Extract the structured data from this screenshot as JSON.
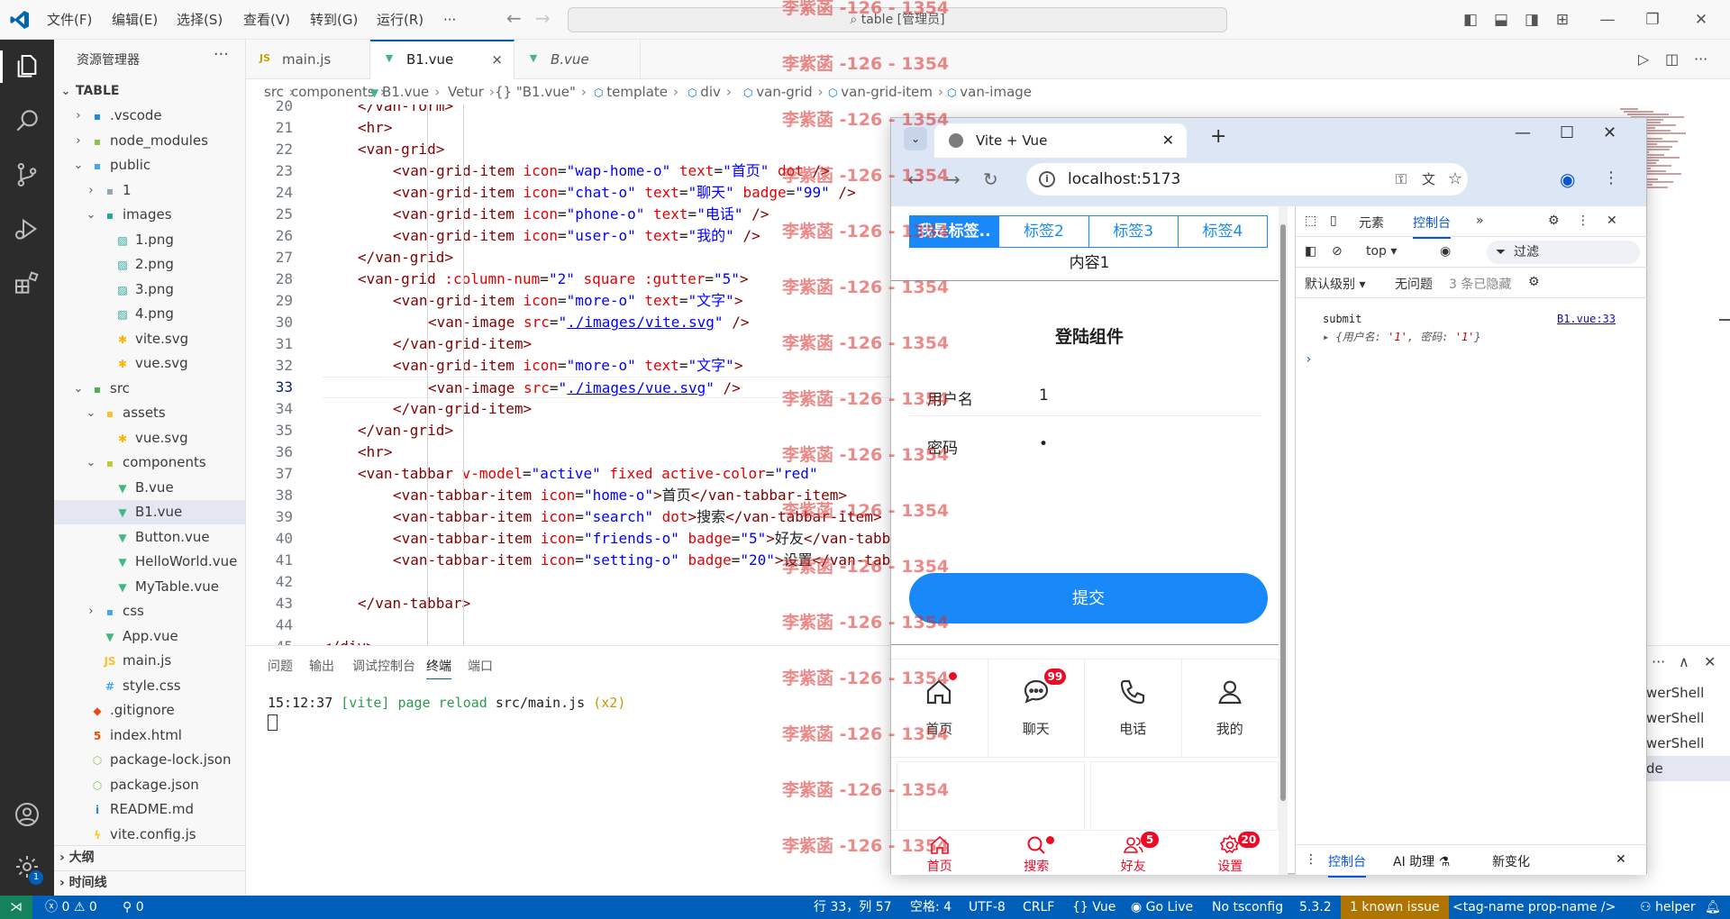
{
  "titlebar": {
    "menus": [
      "文件(F)",
      "编辑(E)",
      "选择(S)",
      "查看(V)",
      "转到(G)",
      "运行(R)",
      "···"
    ],
    "command_center": "table [管理员]"
  },
  "explorer": {
    "title": "资源管理器",
    "root": "TABLE",
    "items": [
      {
        "label": ".vscode",
        "depth": 1,
        "chev": "›",
        "icon": "folder-vscode"
      },
      {
        "label": "node_modules",
        "depth": 1,
        "chev": "›",
        "icon": "folder-node"
      },
      {
        "label": "public",
        "depth": 1,
        "chev": "⌄",
        "icon": "folder-public"
      },
      {
        "label": "1",
        "depth": 2,
        "chev": "›",
        "icon": "folder"
      },
      {
        "label": "images",
        "depth": 2,
        "chev": "⌄",
        "icon": "folder-images"
      },
      {
        "label": "1.png",
        "depth": 3,
        "chev": "",
        "icon": "image"
      },
      {
        "label": "2.png",
        "depth": 3,
        "chev": "",
        "icon": "image"
      },
      {
        "label": "3.png",
        "depth": 3,
        "chev": "",
        "icon": "image"
      },
      {
        "label": "4.png",
        "depth": 3,
        "chev": "",
        "icon": "image"
      },
      {
        "label": "vite.svg",
        "depth": 3,
        "chev": "",
        "icon": "svg"
      },
      {
        "label": "vue.svg",
        "depth": 3,
        "chev": "",
        "icon": "svg"
      },
      {
        "label": "src",
        "depth": 1,
        "chev": "⌄",
        "icon": "folder-src"
      },
      {
        "label": "assets",
        "depth": 2,
        "chev": "⌄",
        "icon": "folder-assets"
      },
      {
        "label": "vue.svg",
        "depth": 3,
        "chev": "",
        "icon": "svg"
      },
      {
        "label": "components",
        "depth": 2,
        "chev": "⌄",
        "icon": "folder-components"
      },
      {
        "label": "B.vue",
        "depth": 3,
        "chev": "",
        "icon": "vue"
      },
      {
        "label": "B1.vue",
        "depth": 3,
        "chev": "",
        "icon": "vue",
        "selected": true
      },
      {
        "label": "Button.vue",
        "depth": 3,
        "chev": "",
        "icon": "vue"
      },
      {
        "label": "HelloWorld.vue",
        "depth": 3,
        "chev": "",
        "icon": "vue"
      },
      {
        "label": "MyTable.vue",
        "depth": 3,
        "chev": "",
        "icon": "vue"
      },
      {
        "label": "css",
        "depth": 2,
        "chev": "›",
        "icon": "folder-css"
      },
      {
        "label": "App.vue",
        "depth": 2,
        "chev": "",
        "icon": "vue"
      },
      {
        "label": "main.js",
        "depth": 2,
        "chev": "",
        "icon": "js"
      },
      {
        "label": "style.css",
        "depth": 2,
        "chev": "",
        "icon": "css"
      },
      {
        "label": ".gitignore",
        "depth": 1,
        "chev": "",
        "icon": "git"
      },
      {
        "label": "index.html",
        "depth": 1,
        "chev": "",
        "icon": "html"
      },
      {
        "label": "package-lock.json",
        "depth": 1,
        "chev": "",
        "icon": "node"
      },
      {
        "label": "package.json",
        "depth": 1,
        "chev": "",
        "icon": "node"
      },
      {
        "label": "README.md",
        "depth": 1,
        "chev": "",
        "icon": "info"
      },
      {
        "label": "vite.config.js",
        "depth": 1,
        "chev": "",
        "icon": "vite"
      }
    ],
    "outline": "大纲",
    "timeline": "时间线"
  },
  "tabs": [
    {
      "label": "main.js",
      "icon": "js"
    },
    {
      "label": "B1.vue",
      "icon": "vue",
      "active": true,
      "close": "×"
    },
    {
      "label": "B.vue",
      "icon": "vue",
      "italic": true
    }
  ],
  "breadcrumb": [
    "src",
    "components",
    "B1.vue",
    "Vetur",
    "{} \"B1.vue\"",
    "template",
    "div",
    "van-grid",
    "van-grid-item",
    "van-image"
  ],
  "editor": {
    "line_numbers": [
      "20",
      "21",
      "22",
      "23",
      "24",
      "25",
      "26",
      "27",
      "28",
      "29",
      "30",
      "31",
      "32",
      "33",
      "34",
      "35",
      "36",
      "37",
      "38",
      "39",
      "40",
      "41",
      "42",
      "43",
      "44",
      "45"
    ],
    "current_line": "33",
    "lines": [
      {
        "i": 2,
        "p": [
          [
            "tg",
            "</van-form>"
          ]
        ]
      },
      {
        "i": 2,
        "p": [
          [
            "tg",
            "<hr>"
          ]
        ]
      },
      {
        "i": 2,
        "p": [
          [
            "tg",
            "<van-grid>"
          ]
        ]
      },
      {
        "i": 3,
        "p": [
          [
            "tg",
            "<van-grid-item "
          ],
          [
            "at",
            "icon"
          ],
          [
            "tx",
            "="
          ],
          [
            "st",
            "\"wap-home-o\""
          ],
          [
            "at",
            " text"
          ],
          [
            "tx",
            "="
          ],
          [
            "st",
            "\"首页\""
          ],
          [
            "at",
            " dot"
          ],
          [
            "tg",
            " />"
          ]
        ]
      },
      {
        "i": 3,
        "p": [
          [
            "tg",
            "<van-grid-item "
          ],
          [
            "at",
            "icon"
          ],
          [
            "tx",
            "="
          ],
          [
            "st",
            "\"chat-o\""
          ],
          [
            "at",
            " text"
          ],
          [
            "tx",
            "="
          ],
          [
            "st",
            "\"聊天\""
          ],
          [
            "at",
            " badge"
          ],
          [
            "tx",
            "="
          ],
          [
            "st",
            "\"99\""
          ],
          [
            "tg",
            " />"
          ]
        ]
      },
      {
        "i": 3,
        "p": [
          [
            "tg",
            "<van-grid-item "
          ],
          [
            "at",
            "icon"
          ],
          [
            "tx",
            "="
          ],
          [
            "st",
            "\"phone-o\""
          ],
          [
            "at",
            " text"
          ],
          [
            "tx",
            "="
          ],
          [
            "st",
            "\"电话\""
          ],
          [
            "tg",
            " />"
          ]
        ]
      },
      {
        "i": 3,
        "p": [
          [
            "tg",
            "<van-grid-item "
          ],
          [
            "at",
            "icon"
          ],
          [
            "tx",
            "="
          ],
          [
            "st",
            "\"user-o\""
          ],
          [
            "at",
            " text"
          ],
          [
            "tx",
            "="
          ],
          [
            "st",
            "\"我的\""
          ],
          [
            "tg",
            " />"
          ]
        ]
      },
      {
        "i": 2,
        "p": [
          [
            "tg",
            "</van-grid>"
          ]
        ]
      },
      {
        "i": 2,
        "p": [
          [
            "tg",
            "<van-grid "
          ],
          [
            "at",
            ":column-num"
          ],
          [
            "tx",
            "="
          ],
          [
            "st",
            "\"2\""
          ],
          [
            "at",
            " square"
          ],
          [
            "at",
            " :gutter"
          ],
          [
            "tx",
            "="
          ],
          [
            "st",
            "\"5\""
          ],
          [
            "tg",
            ">"
          ]
        ]
      },
      {
        "i": 3,
        "p": [
          [
            "tg",
            "<van-grid-item "
          ],
          [
            "at",
            "icon"
          ],
          [
            "tx",
            "="
          ],
          [
            "st",
            "\"more-o\""
          ],
          [
            "at",
            " text"
          ],
          [
            "tx",
            "="
          ],
          [
            "st",
            "\"文字\""
          ],
          [
            "tg",
            ">"
          ]
        ]
      },
      {
        "i": 4,
        "p": [
          [
            "tg",
            "<van-image "
          ],
          [
            "at",
            "src"
          ],
          [
            "tx",
            "="
          ],
          [
            "st",
            "\""
          ],
          [
            "ln",
            "./images/vite.svg"
          ],
          [
            "st",
            "\""
          ],
          [
            "tg",
            " />"
          ]
        ]
      },
      {
        "i": 3,
        "p": [
          [
            "tg",
            "</van-grid-item>"
          ]
        ]
      },
      {
        "i": 3,
        "p": [
          [
            "tg",
            "<van-grid-item "
          ],
          [
            "at",
            "icon"
          ],
          [
            "tx",
            "="
          ],
          [
            "st",
            "\"more-o\""
          ],
          [
            "at",
            " text"
          ],
          [
            "tx",
            "="
          ],
          [
            "st",
            "\"文字\""
          ],
          [
            "tg",
            ">"
          ]
        ]
      },
      {
        "i": 4,
        "p": [
          [
            "tg",
            "<van-image "
          ],
          [
            "at",
            "src"
          ],
          [
            "tx",
            "="
          ],
          [
            "st",
            "\""
          ],
          [
            "ln",
            "./images/vue.svg"
          ],
          [
            "st",
            "\""
          ],
          [
            "tg",
            " />"
          ]
        ]
      },
      {
        "i": 3,
        "p": [
          [
            "tg",
            "</van-grid-item>"
          ]
        ]
      },
      {
        "i": 2,
        "p": [
          [
            "tg",
            "</van-grid>"
          ]
        ]
      },
      {
        "i": 2,
        "p": [
          [
            "tg",
            "<hr>"
          ]
        ]
      },
      {
        "i": 2,
        "p": [
          [
            "tg",
            "<van-tabbar "
          ],
          [
            "at",
            "v-model"
          ],
          [
            "tx",
            "="
          ],
          [
            "st",
            "\"active\""
          ],
          [
            "at",
            " fixed"
          ],
          [
            "at",
            " active-color"
          ],
          [
            "tx",
            "="
          ],
          [
            "st",
            "\"red\""
          ]
        ]
      },
      {
        "i": 3,
        "p": [
          [
            "tg",
            "<van-tabbar-item "
          ],
          [
            "at",
            "icon"
          ],
          [
            "tx",
            "="
          ],
          [
            "st",
            "\"home-o\""
          ],
          [
            "tg",
            ">"
          ],
          [
            "tx",
            "首页"
          ],
          [
            "tg",
            "</van-tabbar-item>"
          ]
        ]
      },
      {
        "i": 3,
        "p": [
          [
            "tg",
            "<van-tabbar-item "
          ],
          [
            "at",
            "icon"
          ],
          [
            "tx",
            "="
          ],
          [
            "st",
            "\"search\""
          ],
          [
            "at",
            " dot"
          ],
          [
            "tg",
            ">"
          ],
          [
            "tx",
            "搜索"
          ],
          [
            "tg",
            "</van-tabbar-item>"
          ]
        ]
      },
      {
        "i": 3,
        "p": [
          [
            "tg",
            "<van-tabbar-item "
          ],
          [
            "at",
            "icon"
          ],
          [
            "tx",
            "="
          ],
          [
            "st",
            "\"friends-o\""
          ],
          [
            "at",
            " badge"
          ],
          [
            "tx",
            "="
          ],
          [
            "st",
            "\"5\""
          ],
          [
            "tg",
            ">"
          ],
          [
            "tx",
            "好友"
          ],
          [
            "tg",
            "</van-tabbar-item>"
          ]
        ]
      },
      {
        "i": 3,
        "p": [
          [
            "tg",
            "<van-tabbar-item "
          ],
          [
            "at",
            "icon"
          ],
          [
            "tx",
            "="
          ],
          [
            "st",
            "\"setting-o\""
          ],
          [
            "at",
            " badge"
          ],
          [
            "tx",
            "="
          ],
          [
            "st",
            "\"20\""
          ],
          [
            "tg",
            ">"
          ],
          [
            "tx",
            "设置"
          ],
          [
            "tg",
            "</van-tabbar-item>"
          ]
        ]
      },
      {
        "i": 2,
        "p": []
      },
      {
        "i": 2,
        "p": [
          [
            "tg",
            "</van-tabbar>"
          ]
        ]
      },
      {
        "i": 2,
        "p": []
      },
      {
        "i": 1,
        "p": [
          [
            "tg",
            "</div>"
          ]
        ]
      }
    ]
  },
  "panel": {
    "tabs": [
      "问题",
      "输出",
      "调试控制台",
      "终端",
      "端口"
    ],
    "active_tab": "终端",
    "terminal": {
      "time": "15:12:37",
      "tag": "[vite]",
      "msg": "page reload",
      "path": "src/main.js",
      "count": "(x2)"
    },
    "shells": [
      "werShell",
      "werShell",
      "werShell",
      "de"
    ]
  },
  "statusbar": {
    "errors": "0",
    "warnings": "0",
    "ports": "0",
    "position": "行 33，列 57",
    "spaces": "空格: 4",
    "encoding": "UTF-8",
    "eol": "CRLF",
    "lang": "Vue",
    "golive": "Go Live",
    "tsconfig": "No tsconfig",
    "version": "5.3.2",
    "issue": "1 known issue",
    "tag": "<tag-name prop-name />",
    "helper": "helper"
  },
  "browser": {
    "tab_title": "Vite + Vue",
    "url": "localhost:5173",
    "app": {
      "tabs": [
        "我是标签..",
        "标签2",
        "标签3",
        "标签4"
      ],
      "content": "内容1",
      "form_title": "登陆组件",
      "username_label": "用户名",
      "username_value": "1",
      "password_label": "密码",
      "password_value": "•",
      "submit": "提交",
      "grid": [
        {
          "label": "首页",
          "icon": "home",
          "dot": true
        },
        {
          "label": "聊天",
          "icon": "chat",
          "badge": "99"
        },
        {
          "label": "电话",
          "icon": "phone"
        },
        {
          "label": "我的",
          "icon": "user"
        }
      ],
      "tabbar": [
        {
          "label": "首页",
          "icon": "home",
          "dot": false
        },
        {
          "label": "搜索",
          "icon": "search",
          "dot": true
        },
        {
          "label": "好友",
          "icon": "friends",
          "badge": "5"
        },
        {
          "label": "设置",
          "icon": "setting",
          "badge": "20"
        }
      ]
    },
    "devtools": {
      "tabs": [
        "元素",
        "控制台"
      ],
      "active_tab": "控制台",
      "context": "top",
      "filter": "过滤",
      "level": "默认级别",
      "issues": "无问题",
      "hidden": "3 条已隐藏",
      "log_text": "submit",
      "log_obj_open": "{用户名: ",
      "log_v1": "'1'",
      "log_mid": ", 密码: ",
      "log_v2": "'1'",
      "log_close": "}",
      "log_src": "B1.vue:33",
      "bottom_tabs": [
        "控制台",
        "AI 助理 ⚗",
        "新变化"
      ]
    }
  },
  "watermark": "李紫菡 -126 - 1354",
  "colors": {
    "accent": "#005fb8",
    "vant_blue": "#1989fa",
    "vant_red": "#ee0a24",
    "remote": "#16825d"
  }
}
